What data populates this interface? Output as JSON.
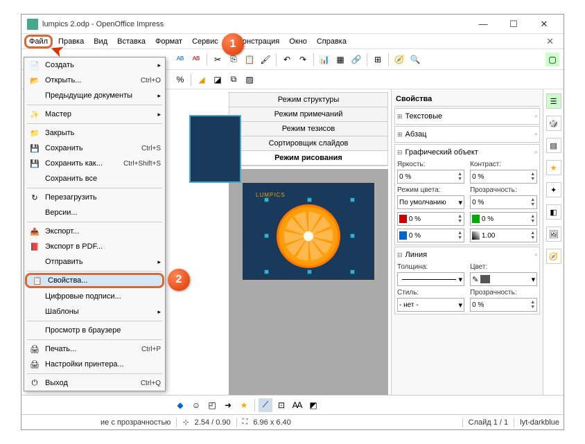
{
  "window": {
    "title": "lumpics 2.odp - OpenOffice Impress"
  },
  "menubar": [
    "Файл",
    "Правка",
    "Вид",
    "Вставка",
    "Формат",
    "Сервис",
    "Демонстрация",
    "Окно",
    "Справка"
  ],
  "file_menu": {
    "new": "Создать",
    "open": "Открыть...",
    "open_sc": "Ctrl+O",
    "recent": "Предыдущие документы",
    "wizard": "Мастер",
    "close": "Закрыть",
    "save": "Сохранить",
    "save_sc": "Ctrl+S",
    "saveas": "Сохранить как...",
    "saveas_sc": "Ctrl+Shift+S",
    "saveall": "Сохранить все",
    "reload": "Перезагрузить",
    "versions": "Версии...",
    "export": "Экспорт...",
    "export_pdf": "Экспорт в PDF...",
    "send": "Отправить",
    "properties": "Свойства...",
    "signatures": "Цифровые подписи...",
    "templates": "Шаблоны",
    "preview": "Просмотр в браузере",
    "print": "Печать...",
    "print_sc": "Ctrl+P",
    "printer": "Настройки принтера...",
    "exit": "Выход",
    "exit_sc": "Ctrl+Q"
  },
  "tabs": {
    "outline": "Режим структуры",
    "notes": "Режим примечаний",
    "handout": "Режим тезисов",
    "sorter": "Сортировщик слайдов",
    "drawing": "Режим рисования"
  },
  "props": {
    "title": "Свойства",
    "text": "Текстовые",
    "para": "Абзац",
    "graphic": "Графический объект",
    "brightness": "Яркость:",
    "contrast": "Контраст:",
    "colormode": "Режим цвета:",
    "transparency": "Прозрачность:",
    "default": "По умолчанию",
    "line": "Линия",
    "thickness": "Толщина:",
    "color": "Цвет:",
    "style": "Стиль:",
    "zero": "0 %",
    "one": "1.00",
    "none": "- нет -"
  },
  "slide": {
    "text": "LUMPICS"
  },
  "status": {
    "desc": "ие с прозрачностью",
    "pos": "2.54 / 0.90",
    "size": "6.96 x 6.40",
    "slide": "Слайд 1 / 1",
    "layout": "lyt-darkblue"
  },
  "callouts": {
    "c1": "1",
    "c2": "2"
  }
}
